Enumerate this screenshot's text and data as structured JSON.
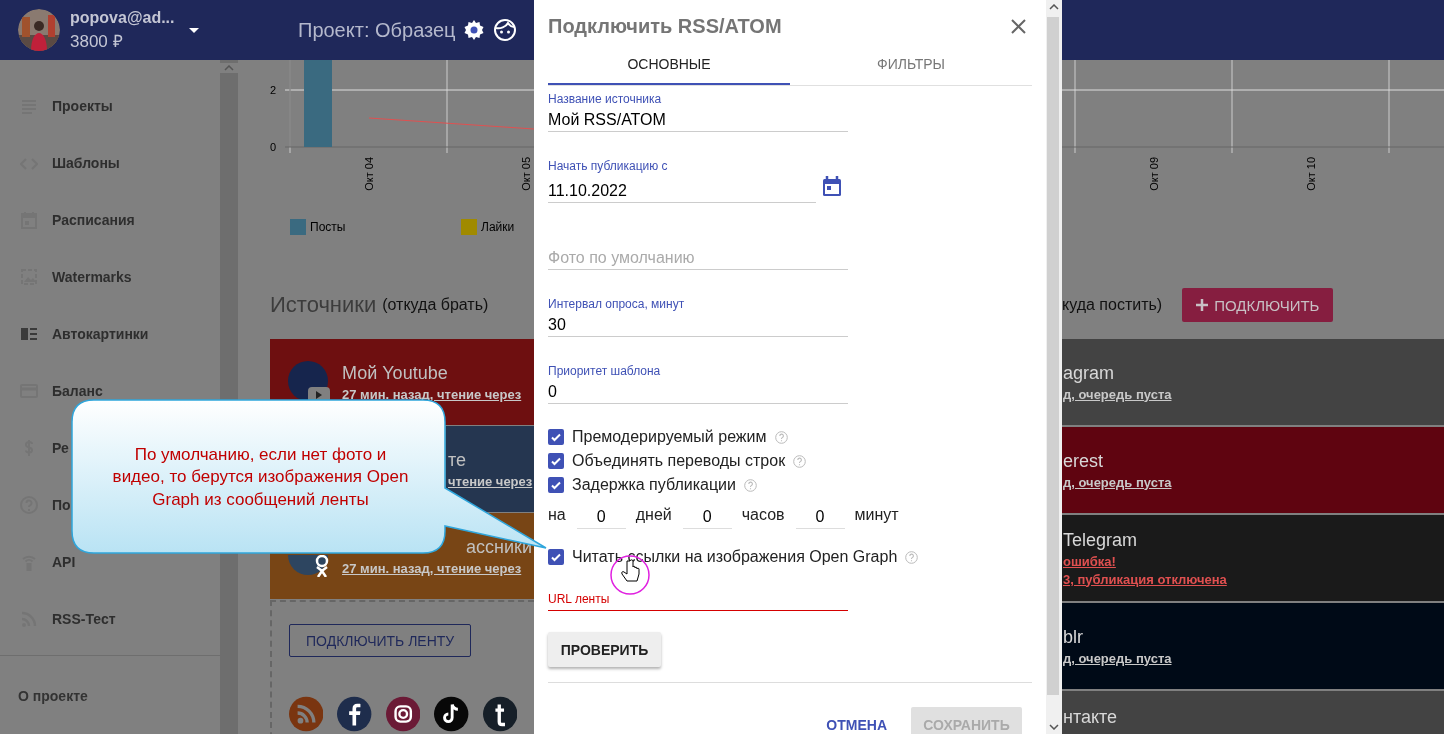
{
  "header": {
    "user_name": "popova@ad...",
    "balance": "3800 ₽",
    "project_title": "Проект: Образец"
  },
  "sidebar": {
    "items": [
      {
        "label": "Проекты"
      },
      {
        "label": "Шаблоны"
      },
      {
        "label": "Расписания"
      },
      {
        "label": "Watermarks"
      },
      {
        "label": "Автокартинки"
      },
      {
        "label": "Баланс"
      },
      {
        "label": "Ре"
      },
      {
        "label": "По"
      },
      {
        "label": "API"
      },
      {
        "label": "RSS-Тест"
      }
    ],
    "footer_link": "О проекте"
  },
  "chart": {
    "y_labels": [
      "2",
      "0"
    ],
    "x_labels": [
      "Окт 04",
      "Окт 05",
      "Окт 09",
      "Окт 10"
    ],
    "legend": [
      {
        "label": "Посты",
        "color": "#3a6a80"
      },
      {
        "label": "Лайки",
        "color": "#a08a00"
      }
    ]
  },
  "sources": {
    "title": "Источники",
    "subtitle": "(откуда брать)",
    "cards": [
      {
        "title": "Мой Youtube",
        "link": "27 мин. назад, чтение через",
        "color": "#6e0f10"
      },
      {
        "title": "те",
        "link": "чтение через",
        "color": "#253650"
      },
      {
        "title": "ассники",
        "link": "27 мин. назад, чтение через",
        "color": "#784515"
      }
    ],
    "connect_button": "ПОДКЛЮЧИТЬ ЛЕНТУ"
  },
  "targets": {
    "subtitle": "куда постить)",
    "connect_button": "ПОДКЛЮЧИТЬ",
    "cards": [
      {
        "title": "agram",
        "links": [
          "д, очередь пуста"
        ],
        "color": "#434343",
        "kind": "ok"
      },
      {
        "title": "erest",
        "links": [
          "д, очередь пуста"
        ],
        "color": "#5f0410",
        "kind": "ok"
      },
      {
        "title": "Telegram",
        "links": [
          "ошибка!",
          "3, публикация отключена"
        ],
        "color": "#1a1a1a",
        "kind": "error"
      },
      {
        "title": "blr",
        "links": [
          "д, очередь пуста"
        ],
        "color": "#000a17",
        "kind": "ok"
      },
      {
        "title": "нтакте",
        "color": "#434343",
        "kind": "ok"
      }
    ]
  },
  "dialog": {
    "title": "Подключить RSS/ATOM",
    "tabs": [
      {
        "label": "ОСНОВНЫЕ",
        "selected": true
      },
      {
        "label": "ФИЛЬТРЫ",
        "selected": false
      }
    ],
    "fields": [
      {
        "kind": "text",
        "label": "Название источника",
        "value": "Мой RSS/ATOM"
      },
      {
        "kind": "date",
        "label": "Начать публикацию с",
        "value": "11.10.2022"
      },
      {
        "kind": "text",
        "placeholder": "Фото по умолчанию"
      },
      {
        "kind": "text",
        "label": "Интервал опроса, минут",
        "value": "30"
      },
      {
        "kind": "text",
        "label": "Приоритет шаблона",
        "value": "0"
      }
    ],
    "options": [
      {
        "label": "Премодерируемый режим",
        "checked": true
      },
      {
        "label": "Объединять переводы строк",
        "checked": true
      },
      {
        "label": "Задержка публикации",
        "checked": true
      }
    ],
    "delay": {
      "prefix": "на",
      "parts": [
        {
          "value": "0",
          "unit": "дней"
        },
        {
          "value": "0",
          "unit": "часов"
        },
        {
          "value": "0",
          "unit": "минут"
        }
      ]
    },
    "open_graph": {
      "label": "Читать ссылки на изображения Open Graph",
      "checked": true
    },
    "url_field": {
      "label": "URL ленты",
      "error": true
    },
    "check_button": "ПРОВЕРИТЬ",
    "cancel_button": "ОТМЕНА",
    "save_button": {
      "label": "СОХРАНИТЬ",
      "disabled": true
    }
  },
  "callout": {
    "text": "По умолчанию, если нет фото и\nвидео, то берутся изображения Open\nGraph из сообщений ленты"
  }
}
